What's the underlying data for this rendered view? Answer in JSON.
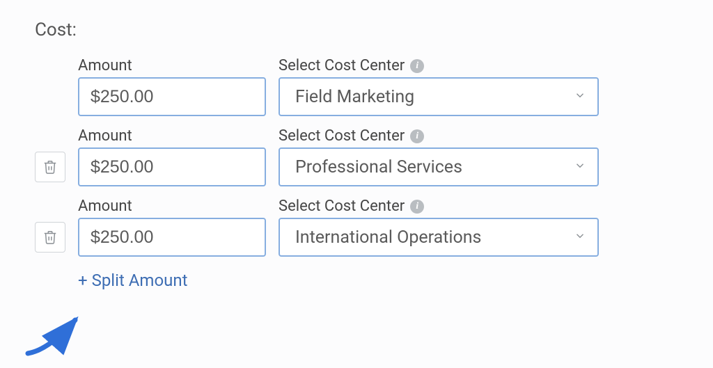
{
  "section_label": "Cost:",
  "labels": {
    "amount": "Amount",
    "cost_center": "Select Cost Center"
  },
  "rows": [
    {
      "amount": "$250.00",
      "cost_center": "Field Marketing",
      "deletable": false
    },
    {
      "amount": "$250.00",
      "cost_center": "Professional Services",
      "deletable": true
    },
    {
      "amount": "$250.00",
      "cost_center": "International Operations",
      "deletable": true
    }
  ],
  "split_link": "+ Split Amount"
}
